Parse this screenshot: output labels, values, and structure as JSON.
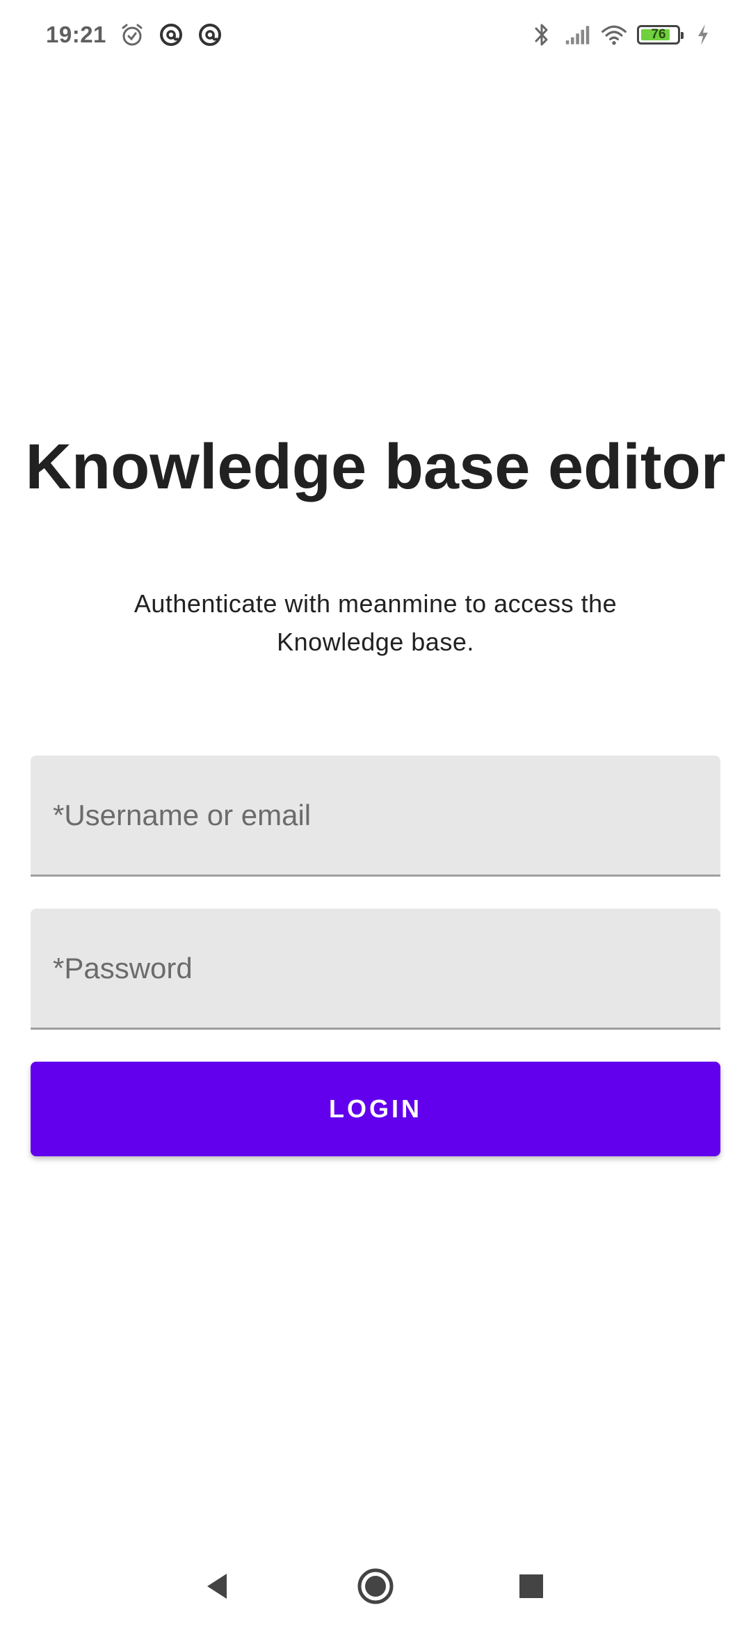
{
  "status_bar": {
    "time": "19:21",
    "battery_level": "76",
    "battery_color": "#6ed13d",
    "icons_left": [
      "alarm-icon",
      "at-sign-icon",
      "at-sign-icon"
    ],
    "icons_right": [
      "bluetooth-icon",
      "signal-icon",
      "wifi-icon",
      "battery-icon",
      "charging-icon"
    ]
  },
  "main": {
    "title": "Knowledge base editor",
    "subtitle": "Authenticate with meanmine to access the Knowledge base.",
    "username_field": {
      "placeholder": "*Username or email",
      "value": ""
    },
    "password_field": {
      "placeholder": "*Password",
      "value": ""
    },
    "login_label": "LOGIN",
    "accent_color": "#6200ee"
  },
  "nav_bar": {
    "buttons": [
      "back-icon",
      "home-icon",
      "recents-icon"
    ]
  }
}
